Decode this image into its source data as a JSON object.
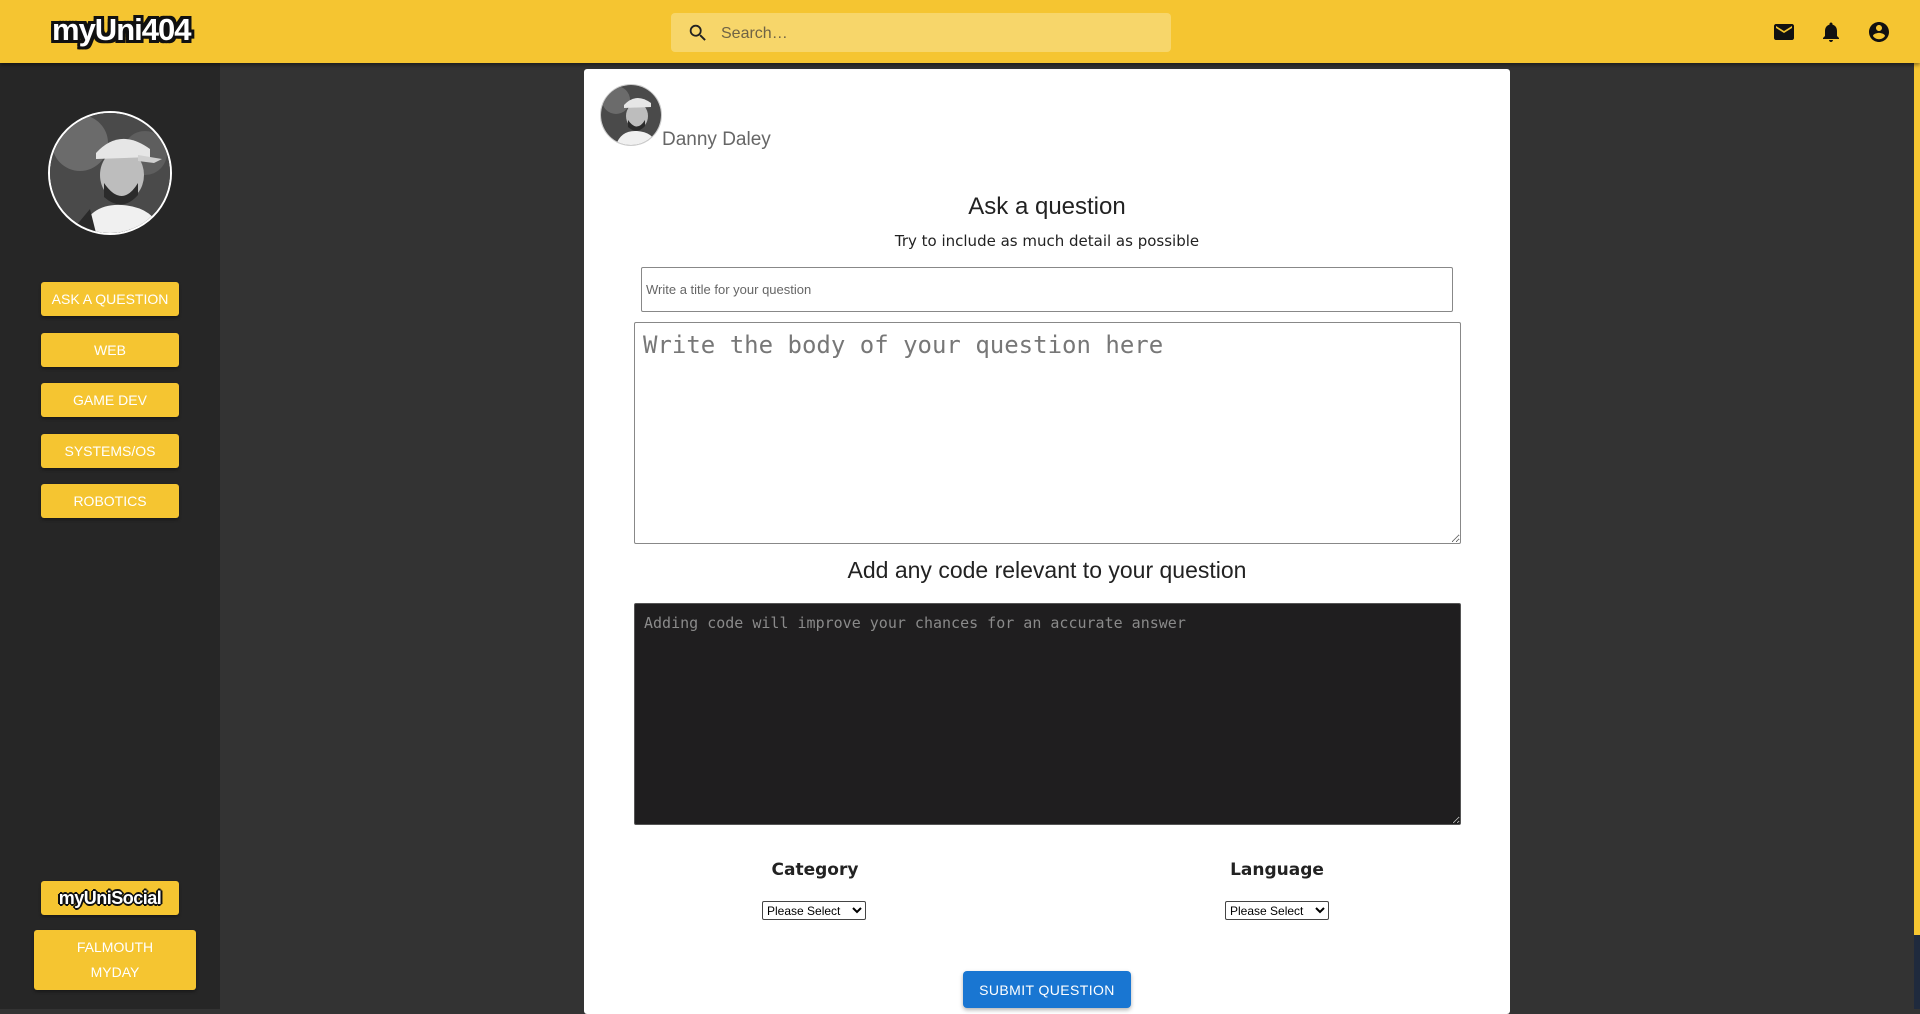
{
  "header": {
    "logo_text": "myUni404",
    "search_placeholder": "Search…",
    "icons": [
      "mail-icon",
      "bell-icon",
      "account-circle-icon"
    ]
  },
  "sidebar": {
    "nav": [
      {
        "label": "Ask a question"
      },
      {
        "label": "Web"
      },
      {
        "label": "Game Dev"
      },
      {
        "label": "Systems/OS"
      },
      {
        "label": "Robotics"
      }
    ],
    "social_logo": "myUniSocial",
    "falmouth_line1": "Falmouth",
    "falmouth_line2": "MyDay"
  },
  "form": {
    "user_name": "Danny Daley",
    "heading": "Ask a question",
    "subheading": "Try to include as much detail as possible",
    "title_placeholder": "Write a title for your question",
    "body_placeholder": "Write the body of your question here",
    "code_heading": "Add any code relevant to your question",
    "code_placeholder": "Adding code will improve your chances for an accurate answer",
    "category_label": "Category",
    "category_value": "Please Select",
    "language_label": "Language",
    "language_value": "Please Select",
    "submit_label": "Submit Question"
  },
  "colors": {
    "accent_yellow": "#f5c531",
    "sidebar_bg": "#262626",
    "page_bg": "#333333",
    "submit_blue": "#1976d2",
    "code_bg": "#1f1e1f"
  }
}
